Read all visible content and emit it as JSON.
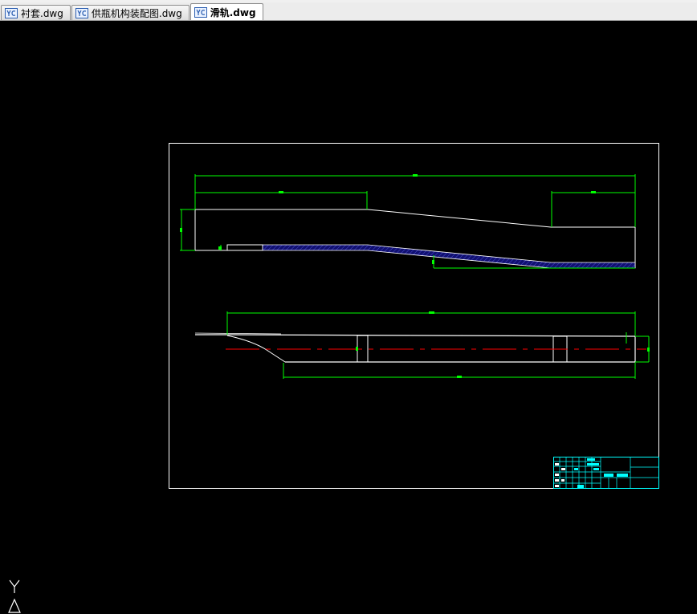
{
  "tabs": [
    {
      "label": "衬套.dwg",
      "active": false,
      "icon": "dwg-file-icon"
    },
    {
      "label": "供瓶机构装配图.dwg",
      "active": false,
      "icon": "dwg-file-icon"
    },
    {
      "label": "滑轨.dwg",
      "active": true,
      "icon": "dwg-file-icon"
    }
  ],
  "colors": {
    "background": "#000000",
    "border": "#ffffff",
    "dimension": "#00ff00",
    "centerline": "#ff0000",
    "hatch": "#1a1a8c",
    "title_block": "#00ffff"
  },
  "ucs": {
    "y_label": "Y"
  }
}
